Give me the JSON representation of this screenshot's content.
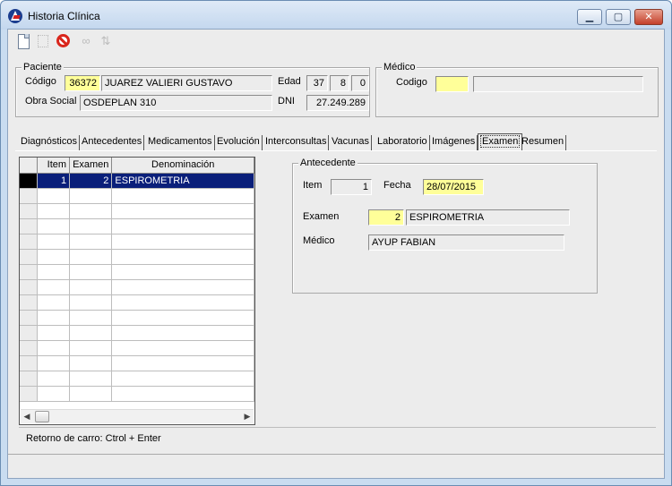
{
  "window": {
    "title": "Historia Clínica",
    "minimize_glyph": "▁",
    "maximize_glyph": "▢",
    "close_glyph": "✕"
  },
  "toolbar": {
    "items": [
      "new-document-icon",
      "blank-icon",
      "cancel-icon",
      "disabled-link-icon",
      "disabled-icon"
    ]
  },
  "paciente": {
    "legend": "Paciente",
    "codigo_label": "Código",
    "codigo": "36372",
    "nombre": "JUAREZ VALIERI GUSTAVO",
    "edad_label": "Edad",
    "edad_anios": "37",
    "edad_meses": "8",
    "edad_dias": "0",
    "obra_social_label": "Obra Social",
    "obra_social": "OSDEPLAN 310",
    "dni_label": "DNI",
    "dni": "27.249.289"
  },
  "medico": {
    "legend": "Médico",
    "codigo_label": "Codigo",
    "codigo": "",
    "nombre": ""
  },
  "tabs": [
    "Diagnósticos",
    "Antecedentes",
    "Medicamentos",
    "Evolución",
    "Interconsultas",
    "Vacunas",
    "Laboratorio",
    "Imágenes",
    "Examen",
    "Resumen"
  ],
  "active_tab": "Examen",
  "grid": {
    "columns": [
      "Item",
      "Examen",
      "Denominación"
    ],
    "rows": [
      {
        "item": "1",
        "examen": "2",
        "denominacion": "ESPIROMETRIA"
      }
    ]
  },
  "antecedente": {
    "legend": "Antecedente",
    "item_label": "Item",
    "item": "1",
    "fecha_label": "Fecha",
    "fecha": "28/07/2015",
    "examen_label": "Examen",
    "examen_codigo": "2",
    "examen_nombre": "ESPIROMETRIA",
    "medico_label": "Médico",
    "medico": "AYUP FABIAN"
  },
  "status": {
    "hint": "Retorno de carro: Ctrol + Enter"
  },
  "colors": {
    "highlight_yellow": "#ffff99",
    "selection_blue": "#0a1f7a",
    "window_frame": "#c9dcf0"
  }
}
